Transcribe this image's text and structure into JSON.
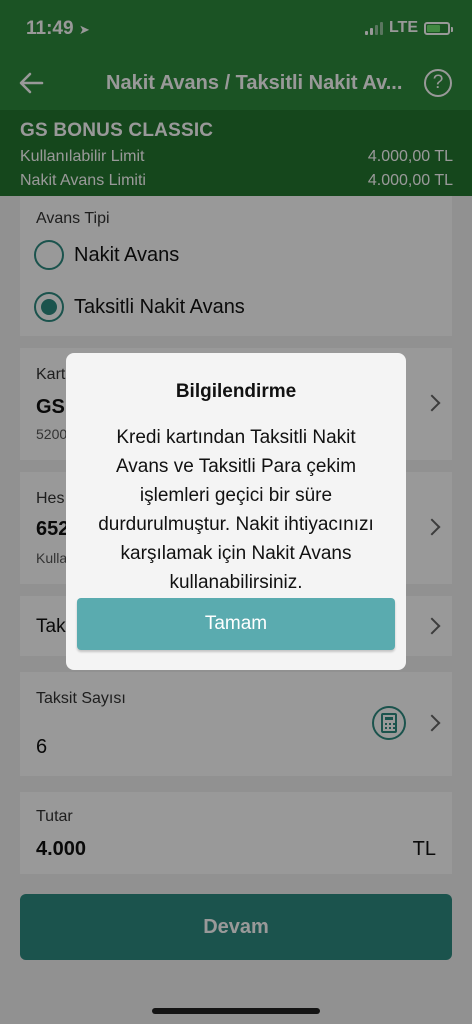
{
  "status_bar": {
    "time": "11:49",
    "network": "LTE"
  },
  "nav": {
    "title": "Nakit Avans / Taksitli Nakit Av...",
    "help_symbol": "?"
  },
  "card": {
    "name": "GS BONUS CLASSIC",
    "available_limit_label": "Kullanılabilir Limit",
    "available_limit_value": "4.000,00 TL",
    "cash_advance_limit_label": "Nakit Avans Limiti",
    "cash_advance_limit_value": "4.000,00 TL"
  },
  "advance_type": {
    "label": "Avans Tipi",
    "options": [
      {
        "label": "Nakit Avans",
        "selected": false
      },
      {
        "label": "Taksitli Nakit Avans",
        "selected": true
      }
    ]
  },
  "card_select": {
    "label": "Kart",
    "value": "GS",
    "number": "5200"
  },
  "account_select": {
    "label": "Hes",
    "value": "652",
    "sub": "Kulla"
  },
  "installment_option": {
    "label": "Tak"
  },
  "installment_count": {
    "label": "Taksit Sayısı",
    "value": "6"
  },
  "amount": {
    "label": "Tutar",
    "value": "4.000",
    "currency": "TL"
  },
  "continue_button": "Devam",
  "dialog": {
    "title": "Bilgilendirme",
    "message": "Kredi kartından Taksitli Nakit Avans ve Taksitli Para çekim işlemleri geçici bir süre durdurulmuştur. Nakit ihtiyacınızı karşılamak için Nakit Avans kullanabilirsiniz.",
    "ok_button": "Tamam"
  },
  "colors": {
    "header_green": "#2d8a3c",
    "card_green": "#24772f",
    "accent_teal": "#2d8a80",
    "dialog_button": "#5aabaf"
  },
  "icons": [
    "location-arrow-icon",
    "signal-icon",
    "battery-icon",
    "back-arrow-icon",
    "help-icon",
    "chevron-right-icon",
    "calculator-icon"
  ]
}
